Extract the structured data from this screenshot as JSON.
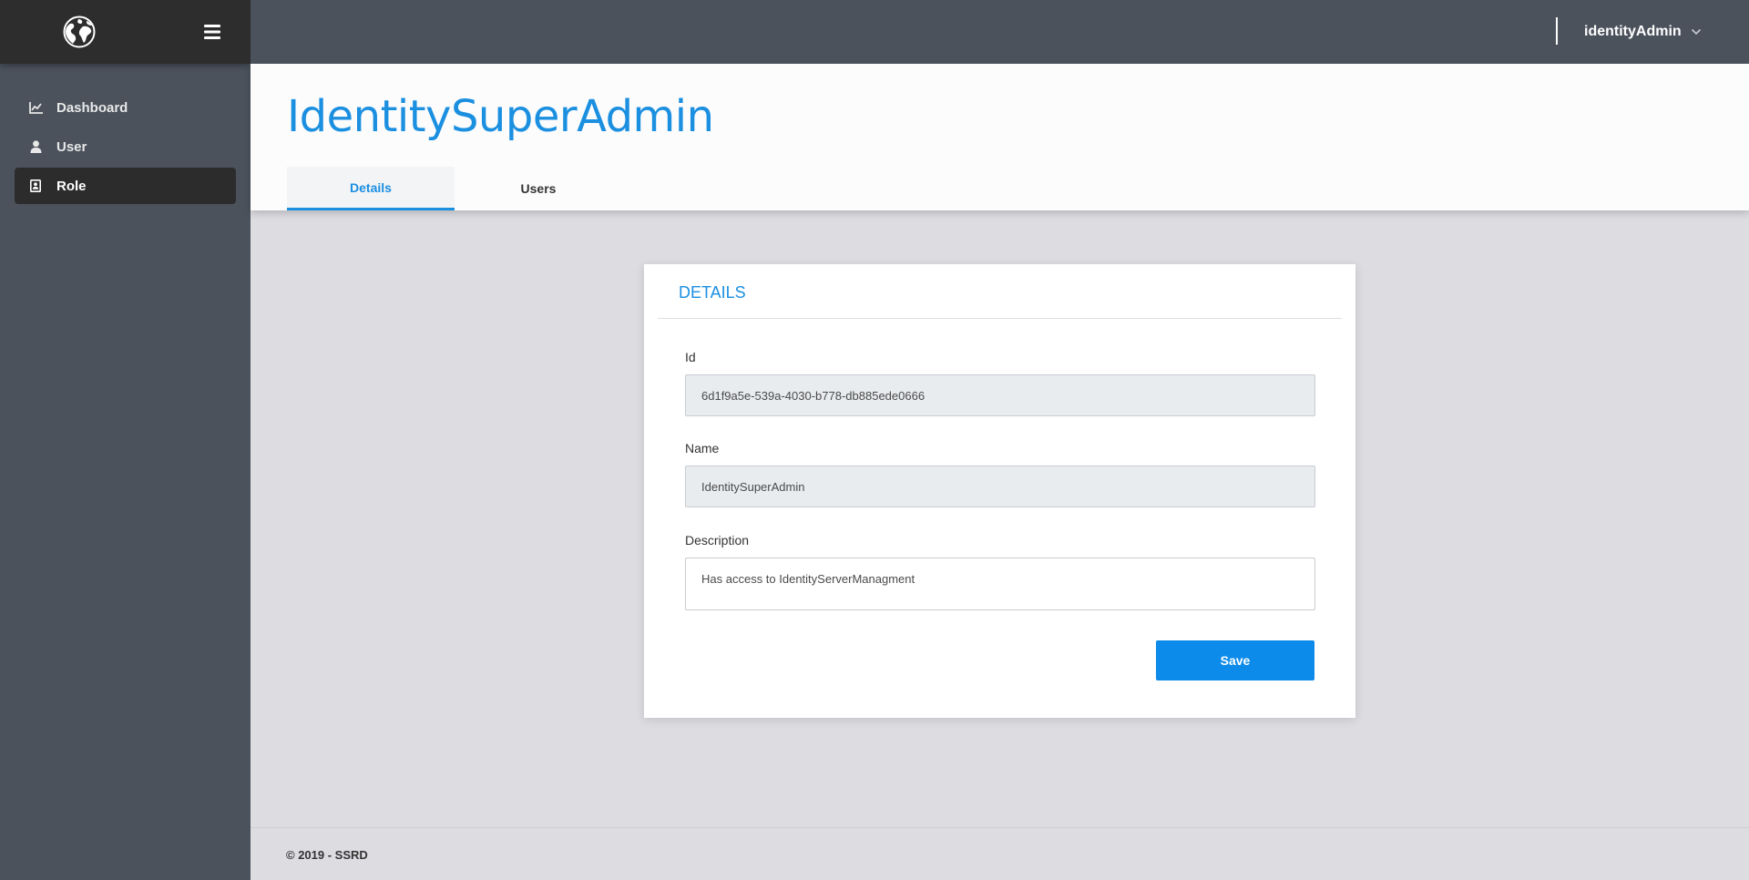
{
  "sidebar": {
    "logo_icon": "globe-icon",
    "menu_icon": "hamburger-icon",
    "items": [
      {
        "label": "Dashboard",
        "icon": "chart-line-icon",
        "active": false
      },
      {
        "label": "User",
        "icon": "user-icon",
        "active": false
      },
      {
        "label": "Role",
        "icon": "id-badge-icon",
        "active": true
      }
    ]
  },
  "topbar": {
    "username": "identityAdmin",
    "dropdown_icon": "chevron-down-icon"
  },
  "header": {
    "title": "IdentitySuperAdmin",
    "tabs": [
      {
        "label": "Details",
        "active": true
      },
      {
        "label": "Users",
        "active": false
      }
    ]
  },
  "card": {
    "title": "DETAILS",
    "fields": {
      "id": {
        "label": "Id",
        "value": "6d1f9a5e-539a-4030-b778-db885ede0666",
        "readonly": true
      },
      "name": {
        "label": "Name",
        "value": "IdentitySuperAdmin",
        "readonly": true
      },
      "description": {
        "label": "Description",
        "value": "Has access to IdentityServerManagment",
        "readonly": false
      }
    },
    "save_label": "Save"
  },
  "footer": {
    "text": "© 2019 - SSRD"
  },
  "colors": {
    "accent": "#1b8fe0",
    "sidebar": "#4b525c",
    "brand_bar": "#2d2d2d",
    "button": "#0d8bea",
    "background": "#dcdce1"
  }
}
